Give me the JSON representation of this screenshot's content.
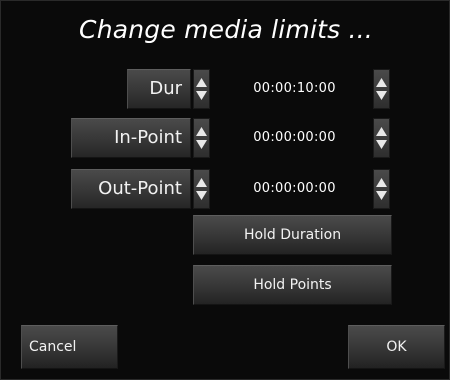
{
  "dialog": {
    "title": "Change media limits ..."
  },
  "fields": [
    {
      "label": "Dur",
      "value": "00:00:10:00"
    },
    {
      "label": "In-Point",
      "value": "00:00:00:00"
    },
    {
      "label": "Out-Point",
      "value": "00:00:00:00"
    }
  ],
  "buttons": {
    "hold_duration": "Hold Duration",
    "hold_points": "Hold Points",
    "cancel": "Cancel",
    "ok": "OK"
  },
  "icons": {
    "spinner": "up-down-arrows-icon"
  },
  "colors": {
    "background": "#0a0a0a",
    "button": "#3a3a3a",
    "text": "#ffffff"
  }
}
